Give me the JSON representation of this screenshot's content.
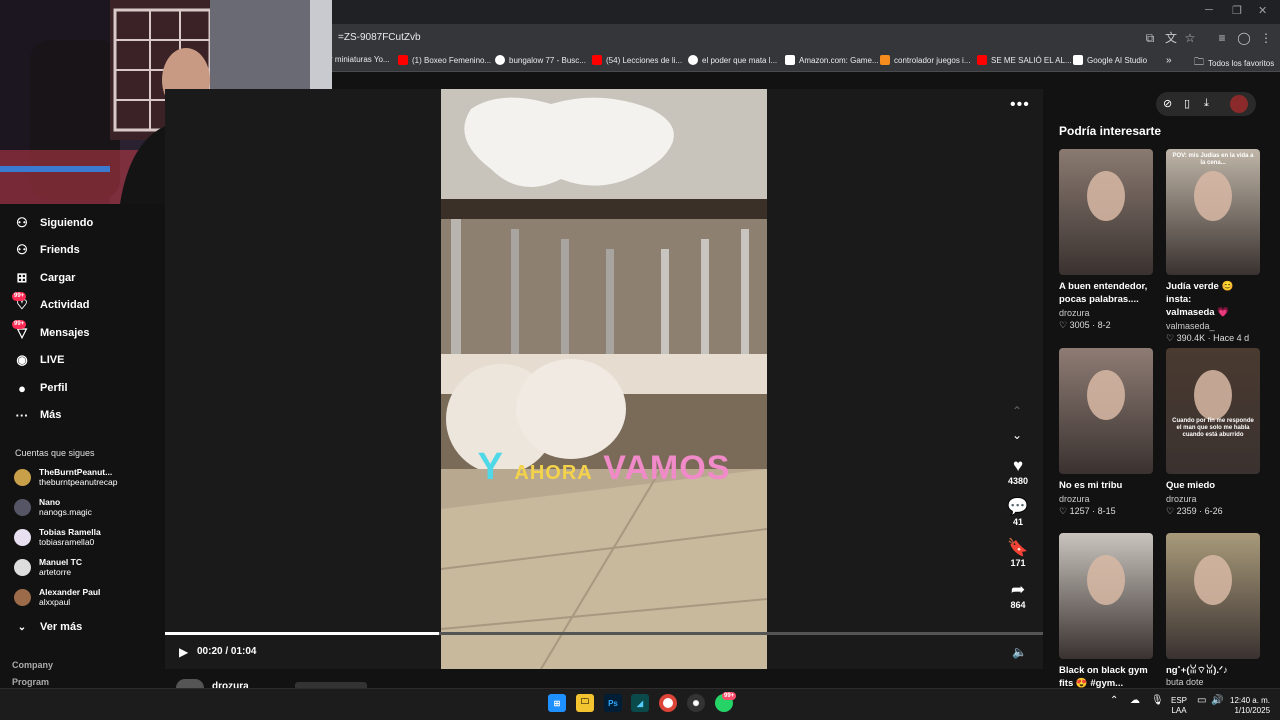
{
  "browser": {
    "url": "=ZS-9087FCutZvb",
    "bookmarks": [
      {
        "label": "r miniaturas Yo...",
        "color": "#ffffff"
      },
      {
        "label": "(1) Boxeo Femenino...",
        "color": "#ff0000"
      },
      {
        "label": "bungalow 77 - Busc...",
        "color": "#4285f4"
      },
      {
        "label": "(54) Lecciones de li...",
        "color": "#ff0000"
      },
      {
        "label": "el poder que mata l...",
        "color": "#4285f4"
      },
      {
        "label": "Amazon.com: Game...",
        "color": "#ffffff"
      },
      {
        "label": "controlador juegos i...",
        "color": "#f68b1e"
      },
      {
        "label": "SE ME SALIÓ EL AL...",
        "color": "#ff0000"
      },
      {
        "label": "Google AI Studio",
        "color": "#ffffff"
      }
    ],
    "all_bookmarks": "Todos los favoritos",
    "overflow": "»"
  },
  "nav": {
    "items": [
      {
        "label": "Siguiendo",
        "icon": "following-icon",
        "glyph": "⚇"
      },
      {
        "label": "Friends",
        "icon": "friends-icon",
        "glyph": "⚇"
      },
      {
        "label": "Cargar",
        "icon": "upload-icon",
        "glyph": "⊞"
      },
      {
        "label": "Actividad",
        "icon": "activity-icon",
        "glyph": "♡",
        "badge": "99+"
      },
      {
        "label": "Mensajes",
        "icon": "messages-icon",
        "glyph": "▽",
        "badge": "99+"
      },
      {
        "label": "LIVE",
        "icon": "live-icon",
        "glyph": "◉"
      },
      {
        "label": "Perfil",
        "icon": "profile-icon",
        "glyph": "●"
      },
      {
        "label": "Más",
        "icon": "more-icon",
        "glyph": "···"
      }
    ],
    "following_title": "Cuentas que sigues",
    "accounts": [
      {
        "name": "TheBurntPeanut...",
        "user": "theburntpeanutrecap",
        "color": "#c9a04a"
      },
      {
        "name": "Nano",
        "user": "nanogs.magic",
        "color": "#555566"
      },
      {
        "name": "Tobias Ramella",
        "user": "tobiasramella0",
        "color": "#e8e0f0"
      },
      {
        "name": "Manuel TC",
        "user": "artetorre",
        "color": "#dddddd"
      },
      {
        "name": "Alexander Paul",
        "user": "alxxpaul",
        "color": "#9b6b4a"
      }
    ],
    "see_more": "Ver más",
    "footer": [
      "Company",
      "Program"
    ]
  },
  "video": {
    "caption_word1": "Y",
    "caption_word2": "AHORA",
    "caption_word3": "VAMOS",
    "likes": "4380",
    "comments": "41",
    "saves": "171",
    "shares": "864",
    "time": "00:20 / 01:04",
    "progress": 0.3125,
    "author": "drozura"
  },
  "recommend": {
    "title": "Podría interesarte",
    "cards": [
      {
        "title1": "A buen entendedor,",
        "title2": "pocas palabras....",
        "author": "drozura",
        "likes": "3005",
        "date": "8-2",
        "bg": "#8a7a70",
        "overlay": ""
      },
      {
        "title1": "Judía verde 😊 insta:",
        "title2": "valmaseda 💗",
        "author": "valmaseda_",
        "likes": "390.4K",
        "date": "Hace 4 d",
        "bg": "#bfb5a8",
        "overlay": "POV: mis Judías en la vida a la cena..."
      },
      {
        "title1": "No es mi tribu",
        "title2": "",
        "author": "drozura",
        "likes": "1257",
        "date": "8-15",
        "bg": "#8e7c74",
        "overlay": ""
      },
      {
        "title1": "Que miedo",
        "title2": "",
        "author": "drozura",
        "likes": "2359",
        "date": "6-26",
        "bg": "#4a3a30",
        "overlay": "Cuando por fin me responde el man que solo me habla cuando está aburrido"
      },
      {
        "title1": "Black on black gym",
        "title2": "fits 😍 #gym...",
        "author": "",
        "likes": "",
        "date": "",
        "bg": "#c9c4be",
        "overlay": ""
      },
      {
        "title1": "ng˚+(ꈍ⌔ꈍ).ᐟ♪",
        "title2": "",
        "author": "buta dote",
        "likes": "",
        "date": "",
        "bg": "#a89a7a",
        "overlay": ""
      }
    ]
  },
  "taskbar": {
    "lang1": "ESP",
    "lang2": "LAA",
    "time": "12:40 a. m.",
    "date": "1/10/2025",
    "whatsapp_badge": "99+"
  }
}
